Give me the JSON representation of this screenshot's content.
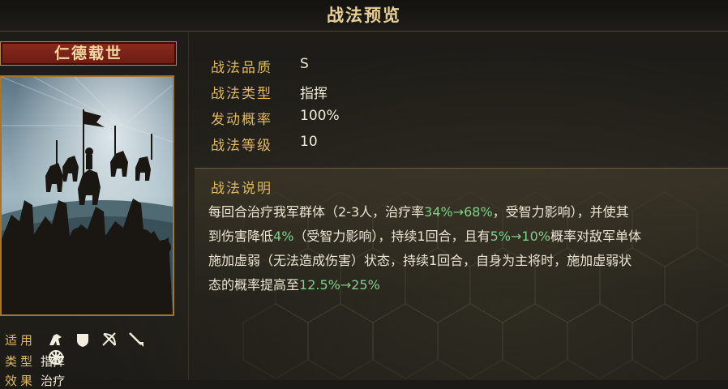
{
  "header": {
    "title": "战法预览"
  },
  "card": {
    "name": "仁德载世",
    "meta": [
      {
        "key": "适用",
        "value": ""
      },
      {
        "key": "类型",
        "value": "指挥"
      },
      {
        "key": "效果",
        "value": "治疗"
      }
    ],
    "troop_icons": [
      "cavalry-icon",
      "shield-icon",
      "bow-icon",
      "spear-icon",
      "chariot-wheel-icon"
    ]
  },
  "attributes": [
    {
      "key": "战法品质",
      "value": "S"
    },
    {
      "key": "战法类型",
      "value": "指挥"
    },
    {
      "key": "发动概率",
      "value": "100%"
    },
    {
      "key": "战法等级",
      "value": "10"
    }
  ],
  "description": {
    "title": "战法说明",
    "lines": [
      [
        "每回合治疗我军群体（2-3人，治疗率",
        "34%→68%",
        "，受智力影响），并使其"
      ],
      [
        "到伤害降低",
        "4%",
        "（受智力影响），持续1回合，且有",
        "5%→10%",
        "概率对敌军单体"
      ],
      [
        "施加虚弱（无法造成伤害）状态，持续1回合，自身为主将时，施加虚弱状"
      ],
      [
        "态的概率提高至",
        "12.5%→25%"
      ]
    ]
  },
  "colors": {
    "accent_gold": "#e0b95a",
    "title_gold": "#e8cf92",
    "highlight_green": "#7fd08a",
    "banner_red": "#7a2418"
  }
}
